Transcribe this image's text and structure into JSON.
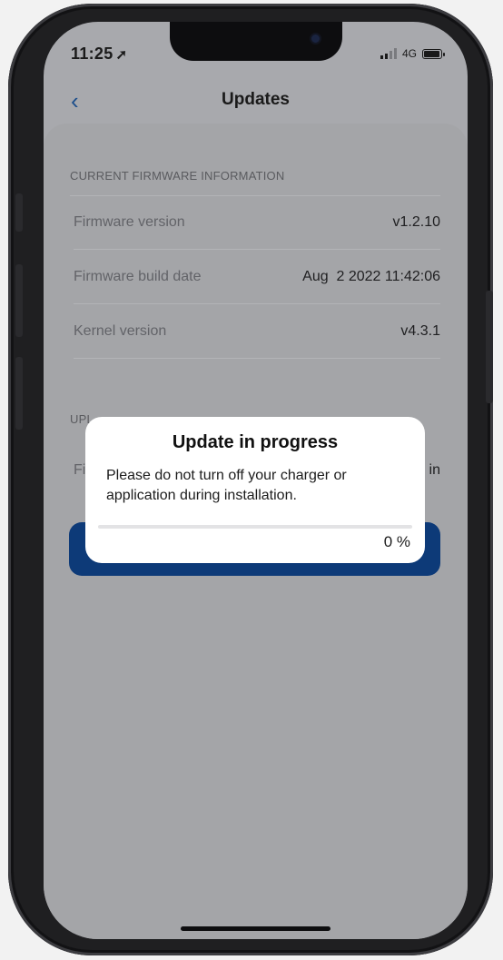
{
  "status_bar": {
    "time": "11:25",
    "network": "4G"
  },
  "nav": {
    "title": "Updates",
    "back_icon": "chevron-left-icon"
  },
  "firmware_info": {
    "header": "CURRENT FIRMWARE INFORMATION",
    "rows": [
      {
        "label": "Firmware version",
        "value": "v1.2.10"
      },
      {
        "label": "Firmware build date",
        "value": "Aug  2 2022 11:42:06"
      },
      {
        "label": "Kernel version",
        "value": "v4.3.1"
      }
    ]
  },
  "upload_section": {
    "header_partial": "UPL",
    "row_label_partial": "Fi",
    "row_value_partial": "in"
  },
  "dialog": {
    "title": "Update in progress",
    "message": "Please do not turn off your charger or application during installation.",
    "progress_label": "0 %",
    "progress_percent": 0
  },
  "colors": {
    "accent": "#0d3a78",
    "back_icon": "#1d4f8c",
    "overlay_bg": "#a8a9ad"
  }
}
